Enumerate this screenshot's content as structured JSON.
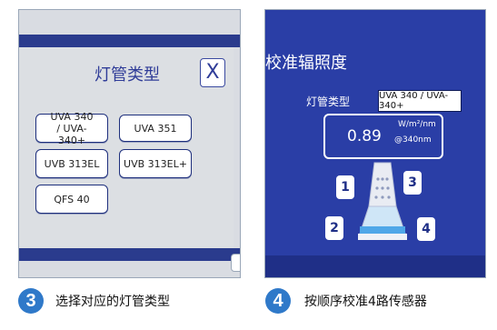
{
  "left": {
    "title": "灯管类型",
    "close_label": "X",
    "buttons": [
      "UVA 340 / UVA-340+",
      "UVA 351",
      "UVB 313EL",
      "UVB 313EL+",
      "QFS 40"
    ]
  },
  "right": {
    "title": "校准辐照度",
    "lamp_type_label": "灯管类型",
    "lamp_type_value": "UVA 340 / UVA-340+",
    "reading_value": "0.89",
    "unit_top": "W/m²/nm",
    "unit_bottom": "@340nm",
    "sensors": [
      "1",
      "2",
      "3",
      "4"
    ]
  },
  "captions": {
    "step3_number": "3",
    "step3_text": "选择对应的灯管类型",
    "step4_number": "4",
    "step4_text": "按顺序校准4路传感器"
  },
  "colors": {
    "accent_blue": "#2a3ea6",
    "title_blue": "#2f3c98",
    "step_blue": "#2f79c9"
  }
}
